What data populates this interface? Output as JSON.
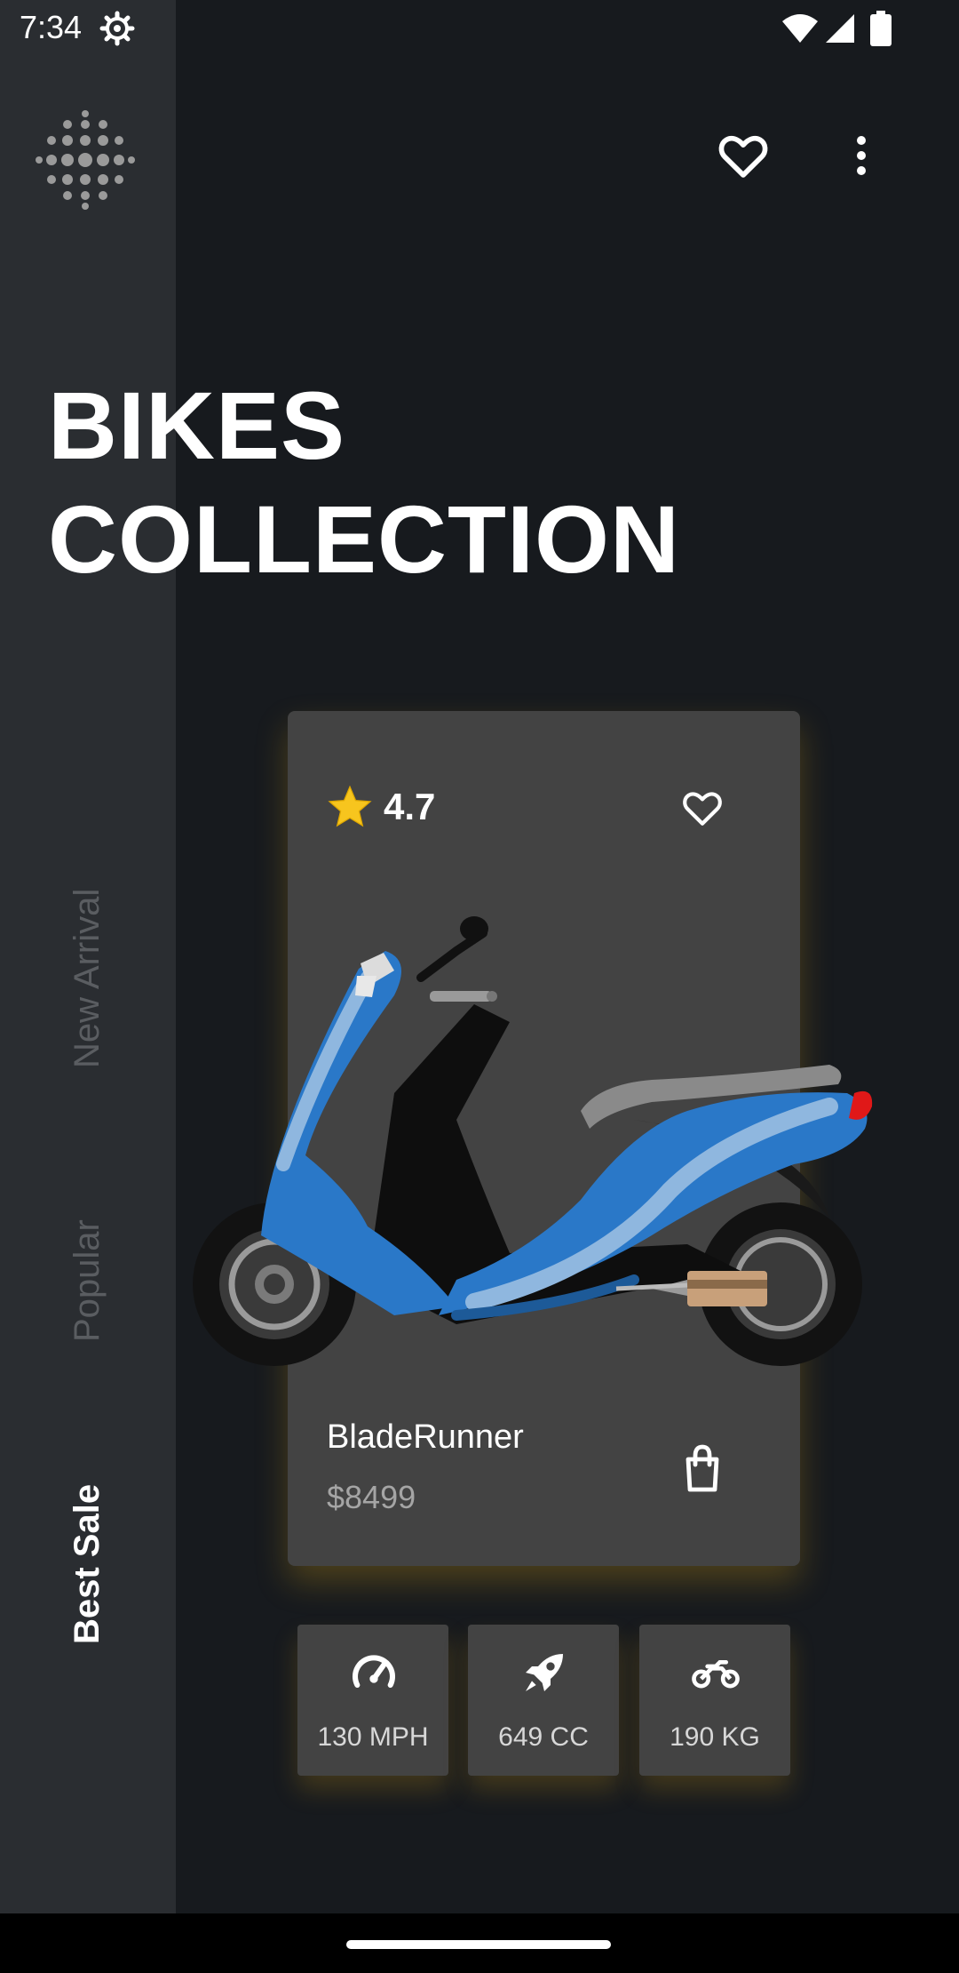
{
  "status_bar": {
    "time": "7:34",
    "icons": [
      "gear-icon",
      "wifi-icon",
      "signal-icon",
      "battery-icon"
    ]
  },
  "header": {
    "logo": "dot-grid-logo",
    "actions": [
      "heart-icon",
      "more-vert-icon"
    ]
  },
  "title": {
    "line1": "BIKES",
    "line2": "COLLECTION"
  },
  "tabs": [
    {
      "label": "New Arrival",
      "active": false
    },
    {
      "label": "Popular",
      "active": false
    },
    {
      "label": "Best Sale",
      "active": true
    }
  ],
  "product": {
    "rating": "4.7",
    "name": "BladeRunner",
    "price": "$8499",
    "image": "blue-scooter"
  },
  "specs": [
    {
      "label": "130 MPH",
      "icon": "speedometer-icon"
    },
    {
      "label": "649 CC",
      "icon": "rocket-icon"
    },
    {
      "label": "190 KG",
      "icon": "motorbike-icon"
    }
  ],
  "colors": {
    "background": "#171a1e",
    "sidebar": "#2a2d31",
    "card": "#434343",
    "glow": "#d4a017",
    "scooter_blue": "#2a78c8"
  }
}
